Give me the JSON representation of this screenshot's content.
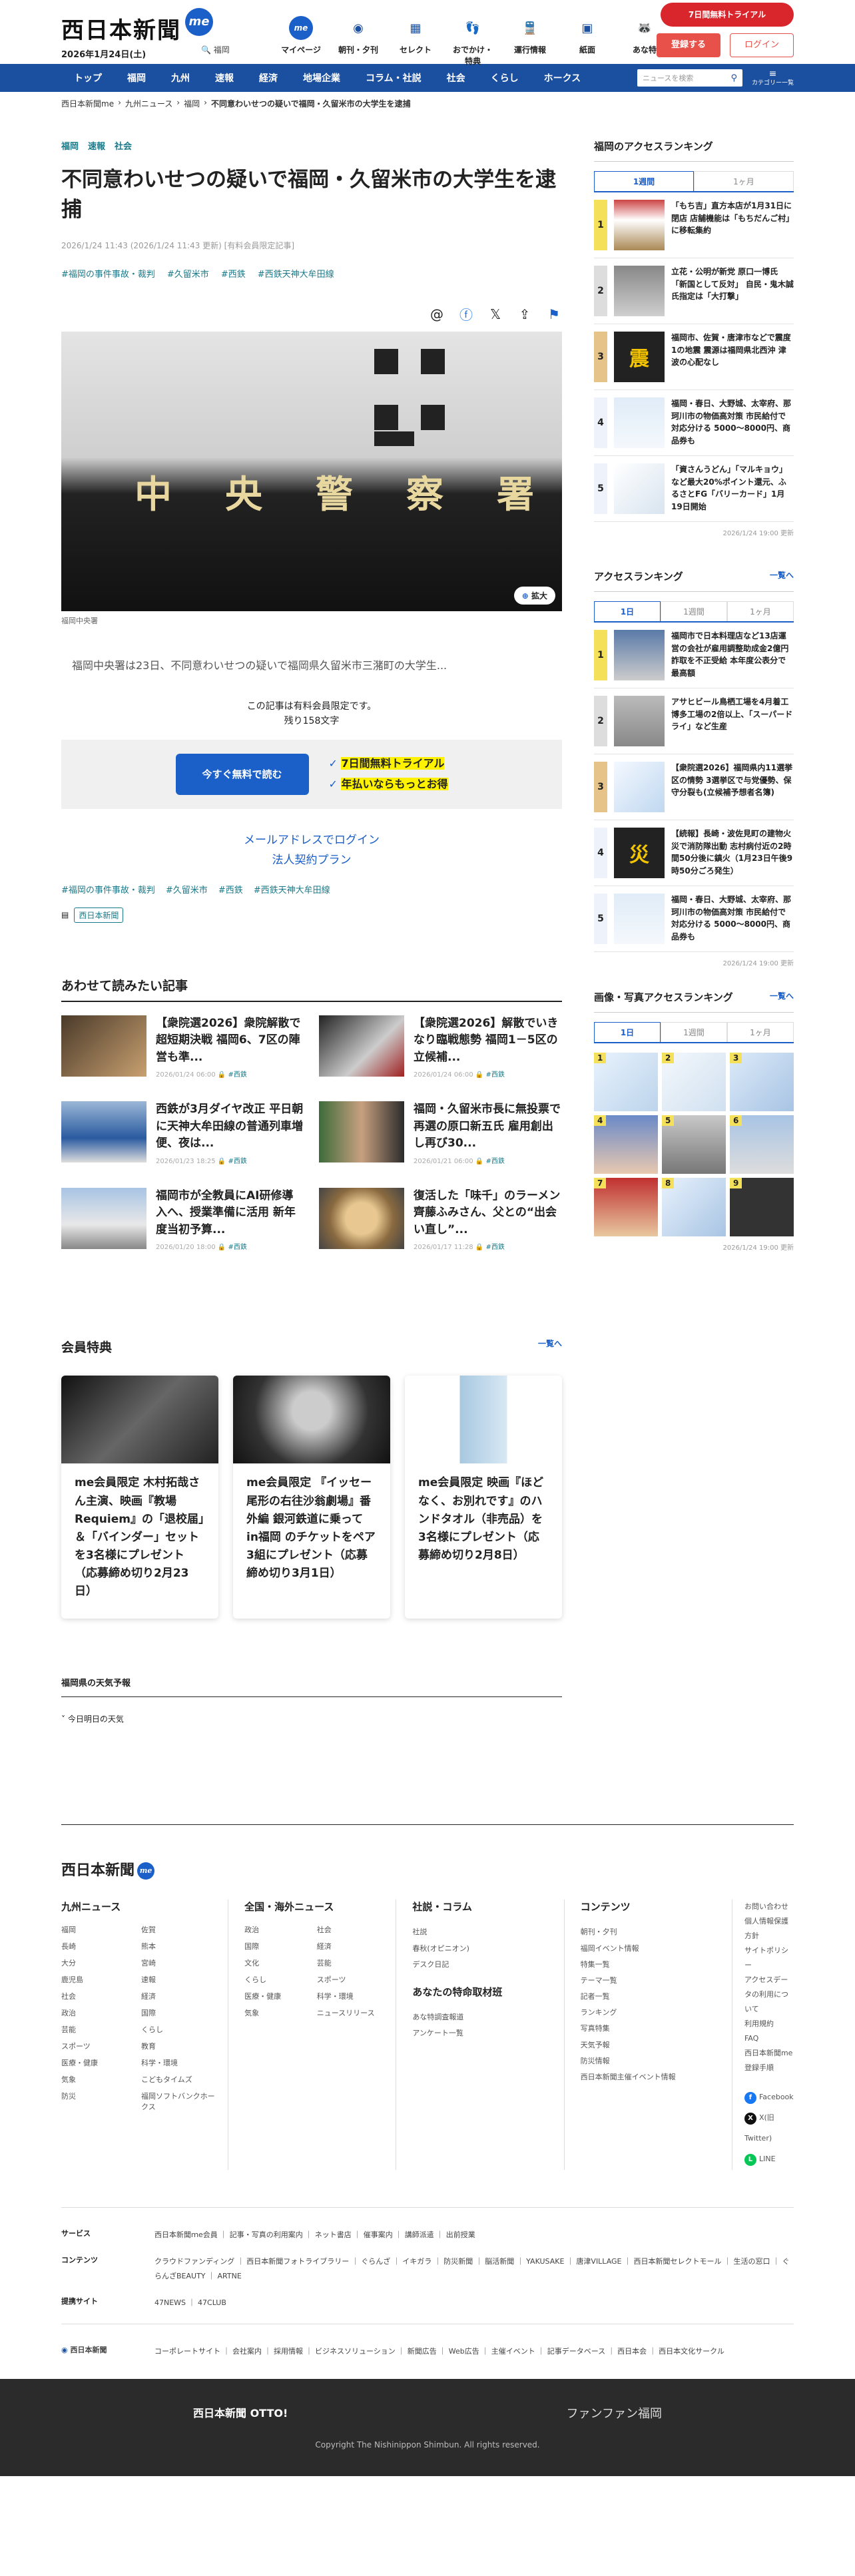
{
  "header": {
    "logo": "西日本新聞",
    "logo_badge": "me",
    "date": "2026年1月24日(土)",
    "location": "福岡",
    "nav": [
      {
        "label": "マイページ",
        "icon": "me-icon"
      },
      {
        "label": "朝刊・夕刊",
        "icon": "newspaper-icon"
      },
      {
        "label": "セレクト",
        "icon": "select-icon"
      },
      {
        "label": "おでかけ・特典",
        "icon": "footprint-icon"
      },
      {
        "label": "運行情報",
        "icon": "train-icon"
      },
      {
        "label": "紙面",
        "icon": "grid-icon"
      },
      {
        "label": "あな特",
        "icon": "raccoon-icon"
      }
    ],
    "trial": "7日間無料トライアル",
    "register": "登録する",
    "login": "ログイン"
  },
  "gnav": {
    "items": [
      "トップ",
      "福岡",
      "九州",
      "速報",
      "経済",
      "地場企業",
      "コラム・社説",
      "社会",
      "くらし",
      "ホークス"
    ],
    "search_placeholder": "ニュースを検索",
    "menu": "カテゴリー一覧"
  },
  "breadcrumb": [
    "西日本新聞me",
    "九州ニュース",
    "福岡",
    "不同意わいせつの疑いで福岡・久留米市の大学生を逮捕"
  ],
  "article": {
    "categories": [
      "福岡",
      "速報",
      "社会"
    ],
    "title": "不同意わいせつの疑いで福岡・久留米市の大学生を逮捕",
    "meta": "2026/1/24 11:43 (2026/1/24 11:43 更新) [有料会員限定記事]",
    "tags": [
      "#福岡の事件事故・裁判",
      "#久留米市",
      "#西鉄",
      "#西鉄天神大牟田線"
    ],
    "photo_sign": [
      "中",
      "央",
      "警",
      "察",
      "署"
    ],
    "zoom": "拡大",
    "caption": "福岡中央署",
    "lead": "福岡中央署は23日、不同意わいせつの疑いで福岡県久留米市三潴町の大学生...",
    "paywall_1": "この記事は有料会員限定です。",
    "paywall_2": "残り158文字",
    "cta": "今すぐ無料で読む",
    "cta_note_1": "7日間無料トライアル",
    "cta_note_2": "年払いならもっとお得",
    "mail_login": "メールアドレスでログイン",
    "corporate": "法人契約プラン",
    "source": "西日本新聞"
  },
  "related": {
    "title": "あわせて読みたい記事",
    "items": [
      {
        "title": "【衆院選2026】衆院解散で超短期決戦 福岡6、7区の陣営も準...",
        "date": "2026/01/24 06:00",
        "cat": "#西鉄"
      },
      {
        "title": "【衆院選2026】解散でいきなり臨戦態勢 福岡1－5区の立候補...",
        "date": "2026/01/24 06:00",
        "cat": "#西鉄"
      },
      {
        "title": "西鉄が3月ダイヤ改正 平日朝に天神大牟田線の普通列車増便、夜は...",
        "date": "2026/01/23 18:25",
        "cat": "#西鉄"
      },
      {
        "title": "福岡・久留米市長に無投票で再選の原口新五氏 雇用創出し再び30...",
        "date": "2026/01/21 06:00",
        "cat": "#西鉄"
      },
      {
        "title": "福岡市が全教員にAI研修導入へ、授業準備に活用 新年度当初予算...",
        "date": "2026/01/20 18:00",
        "cat": "#西鉄"
      },
      {
        "title": "復活した「味千」のラーメン 齊藤ふみさん、父との“出会い直し”...",
        "date": "2026/01/17 11:28",
        "cat": "#西鉄"
      }
    ]
  },
  "benefits": {
    "title": "会員特典",
    "more": "一覧へ",
    "items": [
      "me会員限定 木村拓哉さん主演、映画『教場 Requiem』の「退校届」＆「バインダー」セットを3名様にプレゼント（応募締め切り2月23日）",
      "me会員限定 『イッセー尾形の右往沙翁劇場』番外編 銀河鉄道に乗って in福岡 のチケットをペア3組にプレゼント（応募締め切り3月1日）",
      "me会員限定 映画『ほどなく、お別れです』のハンドタオル（非売品）を3名様にプレゼント（応募締め切り2月8日）"
    ]
  },
  "weather": {
    "title": "福岡県の天気予報",
    "sub": "今日明日の天気"
  },
  "side": {
    "fukuoka_rank": {
      "title": "福岡のアクセスランキング",
      "tabs": [
        "1週間",
        "1ヶ月"
      ],
      "items": [
        "「もち吉」直方本店が1月31日に閉店 店舗機能は「もちだんご村」に移転集約",
        "立花・公明が新党 原口一博氏「新国として反対」 自民・鬼木誠氏指定は「大打撃」",
        "福岡市、佐賀・唐津市などで震度1の地震 震源は福岡県北西沖 津波の心配なし",
        "福岡・春日、大野城、太宰府、那珂川市の物価高対策 市民給付で対応分ける 5000〜8000円、商品券も",
        "「資さんうどん」「マルキョウ」など最大20%ポイント還元、ふるさとFG「バリーカード」1月19日開始"
      ],
      "updated": "2026/1/24 19:00 更新"
    },
    "access_rank": {
      "title": "アクセスランキング",
      "more": "一覧へ",
      "tabs": [
        "1日",
        "1週間",
        "1ヶ月"
      ],
      "items": [
        "福岡市で日本料理店など13店運営の会社が雇用調整助成金2億円詐取を不正受給 本年度公表分で最高額",
        "アサヒビール鳥栖工場を4月着工 博多工場の2倍以上、「スーパードライ」など生産",
        "【衆院選2026】福岡県内11選挙区の情勢 3選挙区で与党優勢、保守分裂も(立候補予想者名簿)",
        "【続報】長崎・波佐見町の建物火災で消防隊出動 志村病付近の2時間50分後に鎮火（1月23日午後9時50分ごろ発生）",
        "福岡・春日、大野城、太宰府、那珂川市の物価高対策 市民給付で対応分ける 5000〜8000円、商品券も"
      ],
      "updated": "2026/1/24 19:00 更新"
    },
    "photo_rank": {
      "title": "画像・写真アクセスランキング",
      "more": "一覧へ",
      "tabs": [
        "1日",
        "1週間",
        "1ヶ月"
      ],
      "nums": [
        "1",
        "2",
        "3",
        "4",
        "5",
        "6",
        "7",
        "8",
        "9"
      ],
      "updated": "2026/1/24 19:00 更新"
    }
  },
  "footer": {
    "logo": "西日本新聞",
    "kyushu": {
      "title": "九州ニュース",
      "items": [
        "福岡",
        "佐賀",
        "長崎",
        "熊本",
        "大分",
        "宮崎",
        "鹿児島",
        "速報",
        "社会",
        "経済",
        "政治",
        "国際",
        "芸能",
        "くらし",
        "スポーツ",
        "教育",
        "医療・健康",
        "科学・環境",
        "気象",
        "こどもタイムズ",
        "防災",
        "福岡ソフトバンクホークス"
      ]
    },
    "national": {
      "title": "全国・海外ニュース",
      "items": [
        "政治",
        "社会",
        "国際",
        "経済",
        "文化",
        "芸能",
        "くらし",
        "スポーツ",
        "医療・健康",
        "科学・環境",
        "気象",
        "ニュースリリース"
      ]
    },
    "column": {
      "title": "社説・コラム",
      "items": [
        "社説",
        "春秋(オピニオン)",
        "デスク日記"
      ],
      "sub_title": "あなたの特命取材班",
      "sub_items": [
        "あな特調査報道",
        "アンケート一覧"
      ]
    },
    "contents": {
      "title": "コンテンツ",
      "items": [
        "朝刊・夕刊",
        "福岡イベント情報",
        "特集一覧",
        "テーマ一覧",
        "記者一覧",
        "ランキング",
        "写真特集",
        "天気予報",
        "防災情報",
        "西日本新聞主催イベント情報"
      ]
    },
    "meta": [
      "お問い合わせ",
      "個人情報保護方針",
      "サイトポリシー",
      "アクセスデータの利用について",
      "利用規約",
      "FAQ",
      "西日本新聞me登録手順"
    ],
    "social": [
      {
        "icon": "facebook-icon",
        "label": "Facebook"
      },
      {
        "icon": "x-icon",
        "label": "X(旧Twitter)"
      },
      {
        "icon": "line-icon",
        "label": "LINE"
      }
    ],
    "service_h": "サービス",
    "service": "西日本新聞ｍe会員 ｜ 記事・写真の利用案内 ｜ ネット書店 ｜ 催事案内 ｜ 講師派遣 ｜ 出前授業",
    "contents_h": "コンテンツ",
    "contents_links": "クラウドファンディング ｜ 西日本新聞フォトライブラリー ｜ ぐらんざ ｜ イキガラ ｜ 防災新聞 ｜ 脳活新聞 ｜ YAKUSAKE ｜ 唐津VILLAGE ｜ 西日本新聞セレクトモール ｜ 生活の窓口 ｜ ぐらんざBEAUTY ｜ ARTNE",
    "partner_h": "提携サイト",
    "partner": "47NEWS ｜ 47CLUB",
    "corp_logo": "西日本新聞",
    "corp": "コーポレートサイト ｜ 会社案内 ｜ 採用情報 ｜ ビジネスソリューション ｜ 新聞広告 ｜ Web広告 ｜ 主催イベント ｜ 記事データベース ｜ 西日本会 ｜ 西日本文化サークル",
    "otto": "西日本新聞 OTTO!",
    "fanfun": "ファンファン福岡",
    "copyright": "Copyright The Nishinippon Shimbun. All rights reserved."
  }
}
